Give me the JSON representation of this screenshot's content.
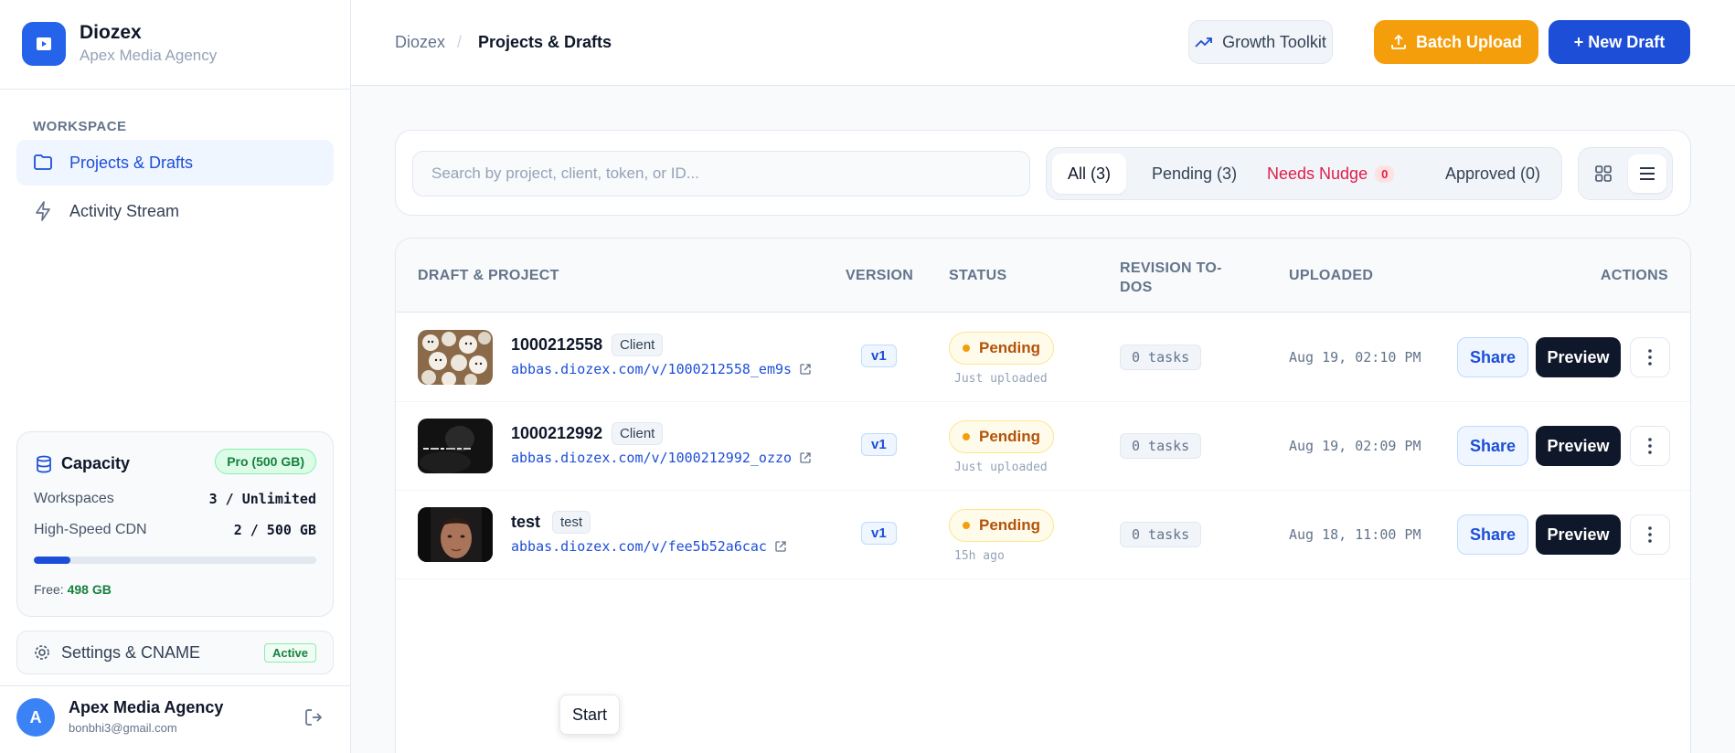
{
  "brand": {
    "name": "Diozex",
    "subtitle": "Apex Media Agency"
  },
  "sidebar": {
    "section_label": "WORKSPACE",
    "items": [
      {
        "label": "Projects & Drafts",
        "icon": "folder-icon",
        "active": true
      },
      {
        "label": "Activity Stream",
        "icon": "lightning-icon",
        "active": false
      }
    ],
    "capacity": {
      "title": "Capacity",
      "plan": "Pro (500 GB)",
      "workspaces_label": "Workspaces",
      "workspaces_value": "3 / Unlimited",
      "cdn_label": "High-Speed CDN",
      "cdn_value": "2 / 500 GB",
      "usage_fraction": 0.13,
      "free_label": "Free:",
      "free_value": "498 GB"
    },
    "settings": {
      "label": "Settings & CNAME",
      "badge": "Active"
    },
    "user": {
      "initial": "A",
      "name": "Apex Media Agency",
      "email": "bonbhi3@gmail.com"
    }
  },
  "header": {
    "breadcrumb_root": "Diozex",
    "breadcrumb_sep": "/",
    "breadcrumb_current": "Projects & Drafts",
    "growth_label": "Growth Toolkit",
    "batch_label": "Batch Upload",
    "new_label": "+ New Draft"
  },
  "filters": {
    "search_placeholder": "Search by project, client, token, or ID...",
    "tabs": [
      {
        "label": "All (3)"
      },
      {
        "label": "Pending (3)"
      },
      {
        "label": "Needs Nudge",
        "badge": "0"
      },
      {
        "label": "Approved (0)"
      }
    ]
  },
  "table": {
    "headers": {
      "draft": "DRAFT & PROJECT",
      "version": "VERSION",
      "status": "STATUS",
      "revision": "REVISION TO-DOS",
      "uploaded": "UPLOADED",
      "actions": "ACTIONS"
    },
    "rows": [
      {
        "name": "1000212558",
        "tag": "Client",
        "url": "abbas.diozex.com/v/1000212558_em9s",
        "version": "v1",
        "status": "Pending",
        "status_sub": "Just uploaded",
        "tasks": "0 tasks",
        "uploaded": "Aug 19, 02:10 PM",
        "share": "Share",
        "preview": "Preview"
      },
      {
        "name": "1000212992",
        "tag": "Client",
        "url": "abbas.diozex.com/v/1000212992_ozzo",
        "version": "v1",
        "status": "Pending",
        "status_sub": "Just uploaded",
        "tasks": "0 tasks",
        "uploaded": "Aug 19, 02:09 PM",
        "share": "Share",
        "preview": "Preview"
      },
      {
        "name": "test",
        "tag": "test",
        "url": "abbas.diozex.com/v/fee5b52a6cac",
        "version": "v1",
        "status": "Pending",
        "status_sub": "15h ago",
        "tasks": "0 tasks",
        "uploaded": "Aug 18, 11:00 PM",
        "share": "Share",
        "preview": "Preview"
      }
    ]
  },
  "tooltip": {
    "label": "Start"
  },
  "colors": {
    "accent": "#1d4ed8",
    "warning": "#f59e0b",
    "danger": "#e11d48",
    "success": "#15803d"
  }
}
